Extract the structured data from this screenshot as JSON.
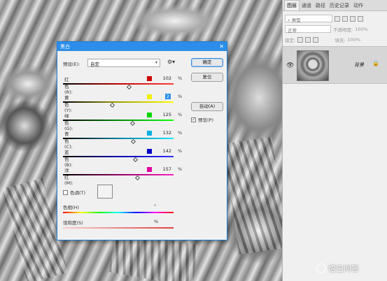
{
  "panel": {
    "tabs": [
      "图层",
      "通道",
      "路径",
      "历史记录",
      "动作"
    ],
    "kind_placeholder": "类型",
    "blend_mode": "正常",
    "opacity_label": "不透明度:",
    "opacity_value": "100%",
    "lock_label": "锁定:",
    "fill_label": "填充:",
    "fill_value": "100%",
    "layer_name": "背景"
  },
  "dialog": {
    "title": "黑白",
    "preset_label": "预设(E):",
    "preset_value": "自定",
    "sliders": [
      {
        "label": "红色(R):",
        "value": "102",
        "color": "#d10000",
        "gradient": "linear-gradient(90deg,#000,#c00000,#ff3c3c)",
        "pos": 0.6
      },
      {
        "label": "黄色(Y):",
        "value": "2",
        "color": "#f0f000",
        "gradient": "linear-gradient(90deg,#000,#a0a000,#ffff00)",
        "pos": 0.45
      },
      {
        "label": "绿色(G):",
        "value": "125",
        "color": "#00d800",
        "gradient": "linear-gradient(90deg,#000,#008800,#10ff10)",
        "pos": 0.63
      },
      {
        "label": "青色(C):",
        "value": "132",
        "color": "#00b0e0",
        "gradient": "linear-gradient(90deg,#000,#0080a0,#20e0ff)",
        "pos": 0.64
      },
      {
        "label": "蓝色(B):",
        "value": "142",
        "color": "#0000c8",
        "gradient": "linear-gradient(90deg,#000,#0000b0,#3030ff)",
        "pos": 0.66
      },
      {
        "label": "洋红(M):",
        "value": "157",
        "color": "#e000a0",
        "gradient": "linear-gradient(90deg,#000,#900060,#ff20c0)",
        "pos": 0.68
      }
    ],
    "percent": "%",
    "tint_label": "色调(T)",
    "hue_label": "色相(H)",
    "hue_unit": "°",
    "saturation_label": "饱和度(S)",
    "saturation_unit": "%",
    "buttons": {
      "ok": "确定",
      "reset": "复位",
      "auto": "自动(A)",
      "preview": "预览(P)"
    },
    "preview_checked": "✓"
  },
  "watermark": "悟空问答"
}
